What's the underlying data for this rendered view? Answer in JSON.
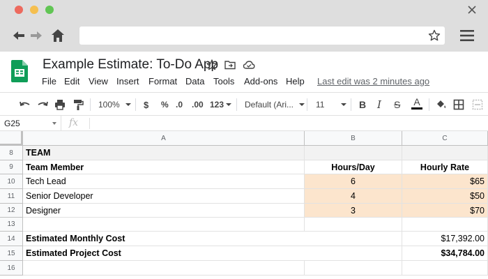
{
  "browser": {
    "url": ""
  },
  "doc": {
    "title": "Example Estimate: To-Do App",
    "last_edit": "Last edit was 2 minutes ago"
  },
  "menu": [
    "File",
    "Edit",
    "View",
    "Insert",
    "Format",
    "Data",
    "Tools",
    "Add-ons",
    "Help"
  ],
  "toolbar": {
    "zoom": "100%",
    "currency": "$",
    "percent": "%",
    "decrease_decimal": ".0",
    "increase_decimal": ".00",
    "more_formats": "123",
    "font": "Default (Ari...",
    "font_size": "11",
    "bold": "B",
    "italic": "I",
    "strikethrough": "S",
    "text_color": "A",
    "text_color_value": "#000000"
  },
  "formula_bar": {
    "name_box": "G25",
    "fx_label": "fx",
    "formula": ""
  },
  "columns": [
    "A",
    "B",
    "C"
  ],
  "rows": [
    {
      "num": "8",
      "cells": [
        "TEAM",
        "",
        ""
      ]
    },
    {
      "num": "9",
      "cells": [
        "Team Member",
        "Hours/Day",
        "Hourly Rate"
      ]
    },
    {
      "num": "10",
      "cells": [
        "Tech Lead",
        "6",
        "$65"
      ]
    },
    {
      "num": "11",
      "cells": [
        "Senior Developer",
        "4",
        "$50"
      ]
    },
    {
      "num": "12",
      "cells": [
        "Designer",
        "3",
        "$70"
      ]
    },
    {
      "num": "13",
      "cells": [
        "",
        "",
        ""
      ]
    },
    {
      "num": "14",
      "cells": [
        "Estimated Monthly Cost",
        "",
        "$17,392.00"
      ]
    },
    {
      "num": "15",
      "cells": [
        "Estimated Project Cost",
        "",
        "$34,784.00"
      ]
    },
    {
      "num": "16",
      "cells": [
        "",
        "",
        ""
      ]
    }
  ],
  "colors": {
    "input_cell_fill": "#fce5cd",
    "section_header_fill": "#f2f2f2",
    "sheets_green": "#0f9d58"
  }
}
